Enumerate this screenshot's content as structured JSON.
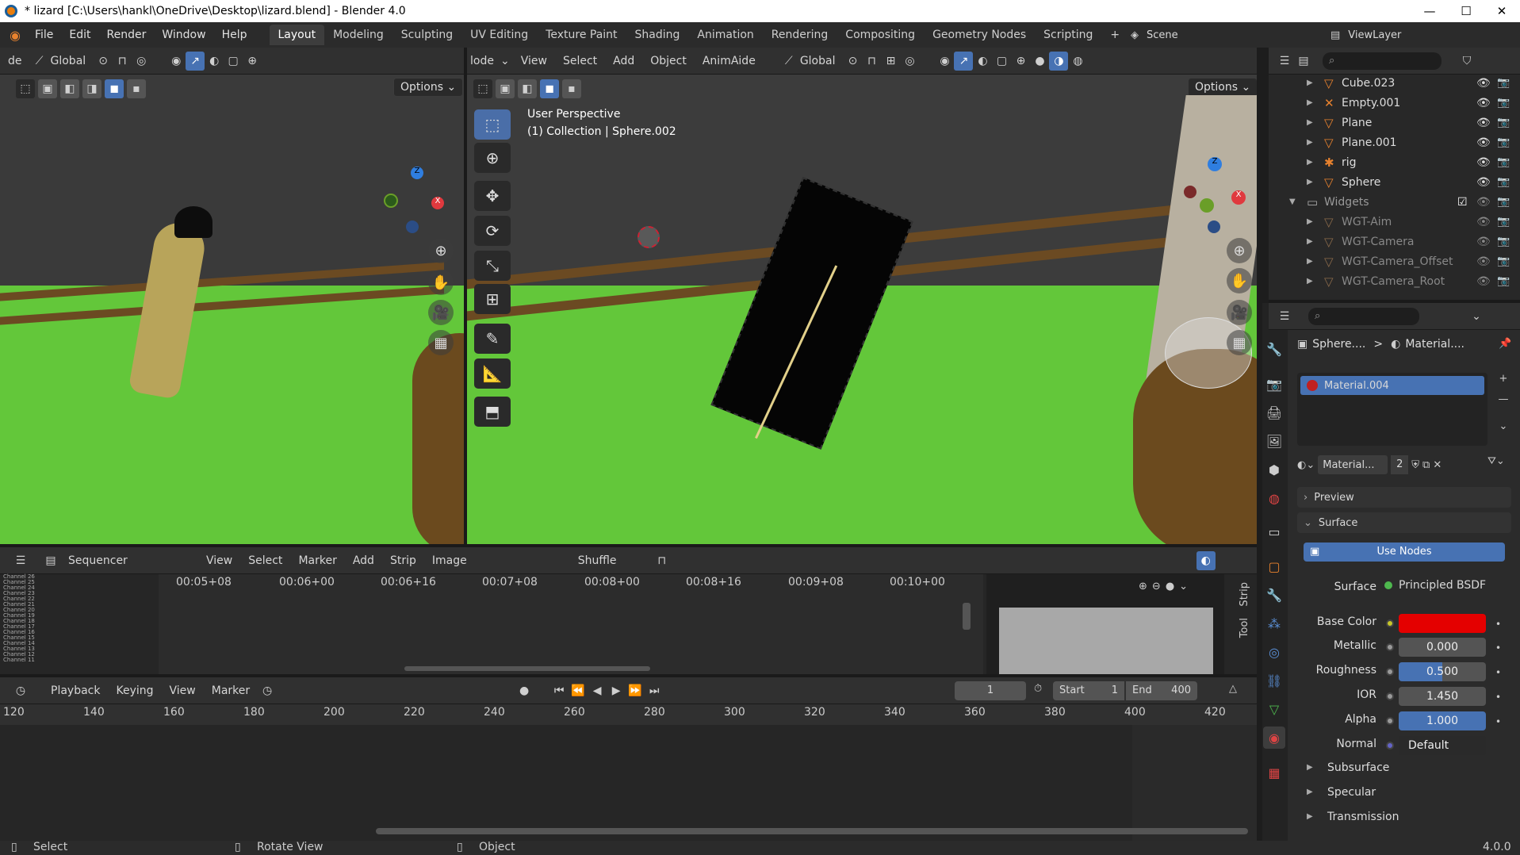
{
  "window": {
    "title": "* lizard [C:\\Users\\hankl\\OneDrive\\Desktop\\lizard.blend] - Blender 4.0",
    "min": "—",
    "max": "☐",
    "close": "✕"
  },
  "menubar": {
    "items": [
      "File",
      "Edit",
      "Render",
      "Window",
      "Help"
    ],
    "workspaces": [
      "Layout",
      "Modeling",
      "Sculpting",
      "UV Editing",
      "Texture Paint",
      "Shading",
      "Animation",
      "Rendering",
      "Compositing",
      "Geometry Nodes",
      "Scripting"
    ],
    "add_tab": "+",
    "scene": "Scene",
    "view_layer": "ViewLayer"
  },
  "left_viewport": {
    "mode_fragment": "de",
    "orientation": "Global",
    "options": "Options"
  },
  "main_viewport": {
    "mode_fragment": "lode",
    "menus": [
      "View",
      "Select",
      "Add",
      "Object",
      "AnimAide"
    ],
    "orientation": "Global",
    "options": "Options",
    "overlay_line1": "User Perspective",
    "overlay_line2": "(1) Collection | Sphere.002"
  },
  "outliner": {
    "rows": [
      {
        "name": "Cube.023"
      },
      {
        "name": "Empty.001"
      },
      {
        "name": "Plane"
      },
      {
        "name": "Plane.001"
      },
      {
        "name": "rig"
      },
      {
        "name": "Sphere"
      },
      {
        "name": "Widgets"
      },
      {
        "name": "WGT-Aim"
      },
      {
        "name": "WGT-Camera"
      },
      {
        "name": "WGT-Camera_Offset"
      },
      {
        "name": "WGT-Camera_Root"
      }
    ]
  },
  "properties": {
    "breadcrumb_object": "Sphere....",
    "breadcrumb_sep": ">",
    "breadcrumb_material": "Material....",
    "material_slot": "Material.004",
    "material_name": "Material...",
    "material_users": "2",
    "preview": "Preview",
    "surface_panel": "Surface",
    "use_nodes": "Use Nodes",
    "surface_label": "Surface",
    "surface_value": "Principled BSDF",
    "base_color_label": "Base Color",
    "base_color": "#e40000",
    "metallic_label": "Metallic",
    "metallic": "0.000",
    "roughness_label": "Roughness",
    "roughness": "0.500",
    "ior_label": "IOR",
    "ior": "1.450",
    "alpha_label": "Alpha",
    "alpha": "1.000",
    "normal_label": "Normal",
    "normal": "Default",
    "subpanels": [
      "Subsurface",
      "Specular",
      "Transmission"
    ]
  },
  "sequencer": {
    "editor": "Sequencer",
    "menus": [
      "View",
      "Select",
      "Marker",
      "Add",
      "Strip",
      "Image"
    ],
    "shuffle": "Shuffle",
    "times": [
      "00:05+08",
      "00:06+00",
      "00:06+16",
      "00:07+08",
      "00:08+00",
      "00:08+16",
      "00:09+08",
      "00:10+00"
    ],
    "side_tabs": [
      "Strip",
      "Tool"
    ],
    "channels": [
      "Channel 26",
      "Channel 25",
      "Channel 24",
      "Channel 23",
      "Channel 22",
      "Channel 21",
      "Channel 20",
      "Channel 19",
      "Channel 18",
      "Channel 17",
      "Channel 16",
      "Channel 15",
      "Channel 14",
      "Channel 13",
      "Channel 12",
      "Channel 11"
    ]
  },
  "timeline": {
    "menus": [
      "Playback",
      "Keying",
      "View",
      "Marker"
    ],
    "current_frame": "1",
    "start_label": "Start",
    "start": "1",
    "end_label": "End",
    "end": "400",
    "ruler": [
      "120",
      "140",
      "160",
      "180",
      "200",
      "220",
      "240",
      "260",
      "280",
      "300",
      "320",
      "340",
      "360",
      "380",
      "400",
      "420"
    ]
  },
  "statusbar": {
    "select": "Select",
    "rotate": "Rotate View",
    "object": "Object",
    "version": "4.0.0"
  }
}
